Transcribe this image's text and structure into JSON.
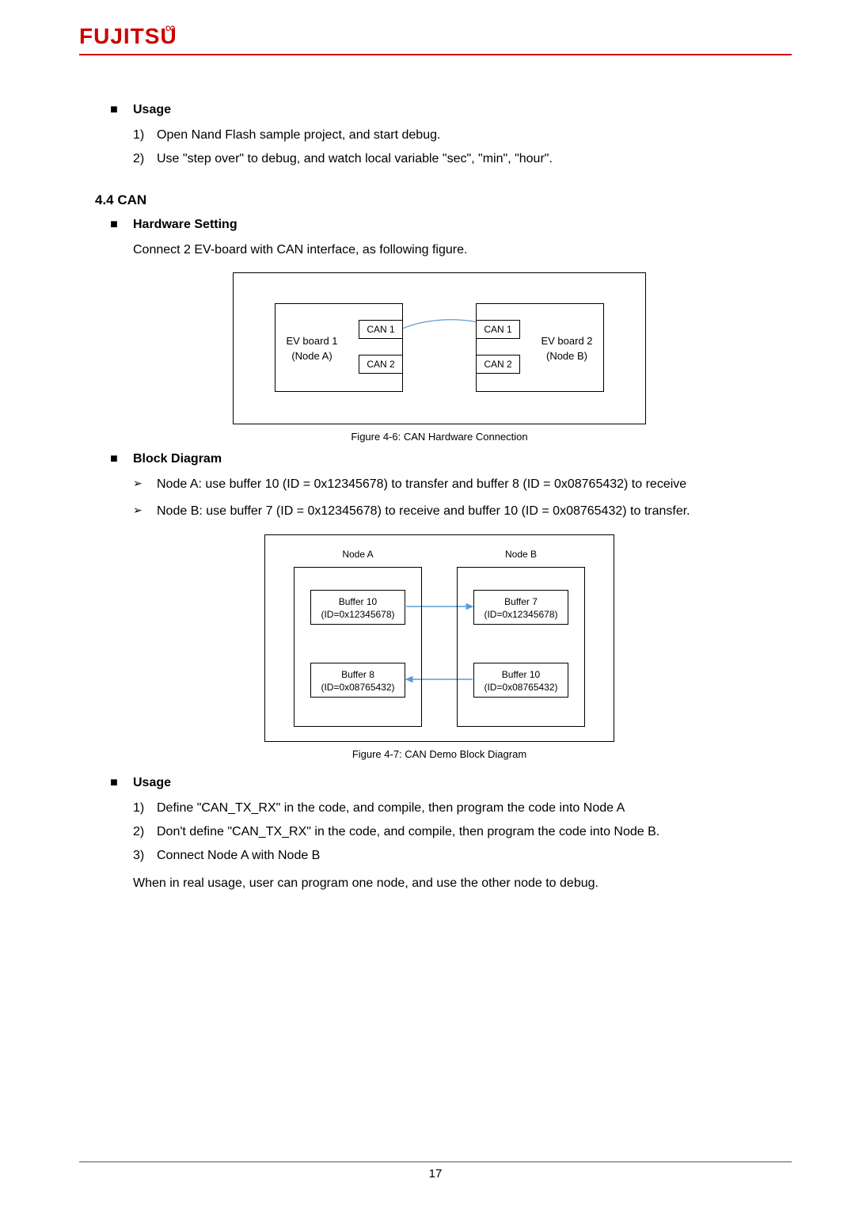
{
  "logo": {
    "text": "FUJITSU"
  },
  "usage1": {
    "heading": "Usage",
    "items": [
      {
        "num": "1)",
        "text": "Open Nand Flash sample project, and start debug."
      },
      {
        "num": "2)",
        "text": "Use \"step over\" to debug, and watch local variable \"sec\", \"min\", \"hour\"."
      }
    ]
  },
  "section": {
    "title": "4.4 CAN"
  },
  "hw": {
    "heading": "Hardware Setting",
    "text": "Connect 2 EV-board with CAN interface, as following figure.",
    "fig": {
      "nodeA": {
        "line1": "EV board 1",
        "line2": "(Node A)"
      },
      "nodeB": {
        "line1": "EV board 2",
        "line2": "(Node B)"
      },
      "can1": "CAN 1",
      "can2": "CAN 2",
      "caption": "Figure 4-6:  CAN Hardware Connection"
    }
  },
  "bd": {
    "heading": "Block Diagram",
    "items": [
      "Node A: use buffer 10 (ID = 0x12345678) to transfer and buffer 8 (ID = 0x08765432) to receive",
      "Node B: use buffer 7 (ID = 0x12345678) to receive and buffer 10 (ID = 0x08765432) to transfer."
    ],
    "fig": {
      "nodeA": "Node A",
      "nodeB": "Node B",
      "a_buf10": {
        "l1": "Buffer 10",
        "l2": "(ID=0x12345678)"
      },
      "a_buf8": {
        "l1": "Buffer 8",
        "l2": "(ID=0x08765432)"
      },
      "b_buf7": {
        "l1": "Buffer 7",
        "l2": "(ID=0x12345678)"
      },
      "b_buf10": {
        "l1": "Buffer 10",
        "l2": "(ID=0x08765432)"
      },
      "caption": "Figure 4-7:  CAN Demo Block Diagram"
    }
  },
  "usage2": {
    "heading": "Usage",
    "items": [
      {
        "num": "1)",
        "text": "Define \"CAN_TX_RX\" in the code, and compile, then program the code into Node A"
      },
      {
        "num": "2)",
        "text": "Don't define \"CAN_TX_RX\" in the code, and compile, then program the code into Node B."
      },
      {
        "num": "3)",
        "text": "Connect Node A with Node B"
      }
    ],
    "note": "When in real usage, user can program one node, and use the other node to debug."
  },
  "page_number": "17"
}
